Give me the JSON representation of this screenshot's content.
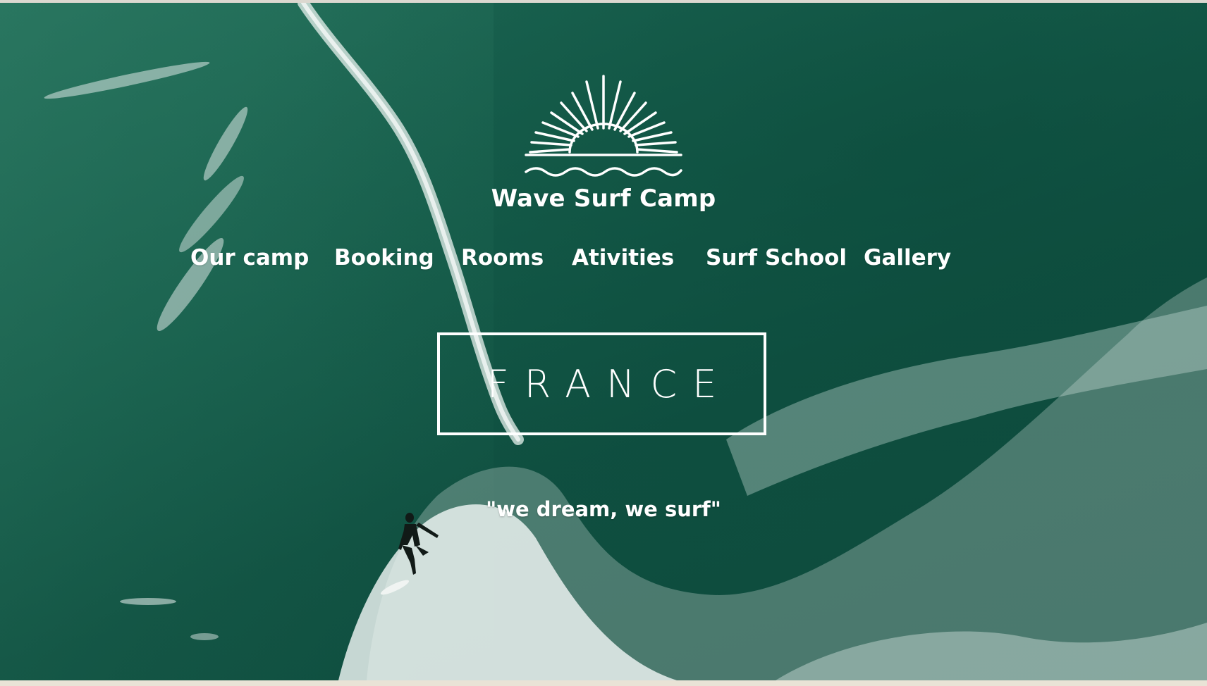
{
  "brand": {
    "name": "Wave Surf Camp",
    "logo_icon": "rising-sun-over-waves-icon"
  },
  "nav": {
    "items": [
      {
        "label": "Our camp"
      },
      {
        "label": "Booking"
      },
      {
        "label": "Rooms"
      },
      {
        "label": "Ativities"
      },
      {
        "label": "Surf School"
      },
      {
        "label": "Gallery"
      }
    ]
  },
  "hero": {
    "location": "FRANCE",
    "tagline": "\"we dream, we surf\"",
    "background": "aerial-ocean-surfer-video"
  },
  "colors": {
    "ocean": "#155c4a",
    "text": "#ffffff",
    "foam": "#f2f7f5"
  }
}
